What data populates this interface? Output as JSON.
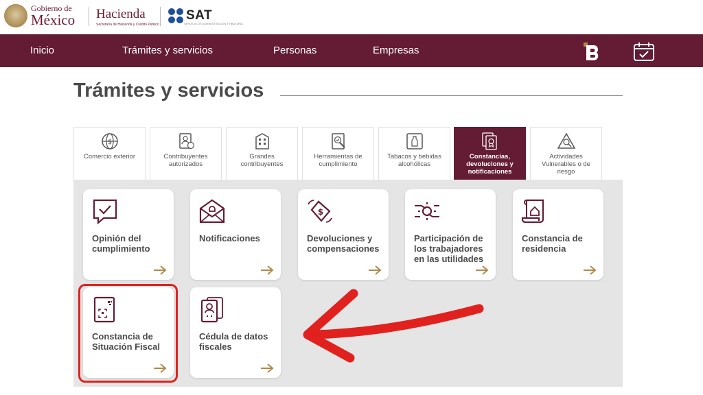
{
  "header": {
    "gob_small": "Gobierno de",
    "gob_big": "México",
    "hacienda_title": "Hacienda",
    "hacienda_sub": "Secretaría de Hacienda y Crédito Público",
    "sat_word": "SAT",
    "sat_sub": "SERVICIO DE ADMINISTRACIÓN TRIBUTARIA"
  },
  "nav": {
    "items": [
      "Inicio",
      "Trámites y servicios",
      "Personas",
      "Empresas"
    ],
    "icons": [
      "b-logo-icon",
      "calendar-check-icon"
    ],
    "color": "#641c34"
  },
  "page": {
    "title": "Trámites y servicios"
  },
  "tabs": [
    {
      "label": "Comercio exterior",
      "icon": "globe-dollar-icon",
      "active": false
    },
    {
      "label": "Contribuyentes autorizados",
      "icon": "document-user-icon",
      "active": false
    },
    {
      "label": "Grandes contribuyentes",
      "icon": "building-icon",
      "active": false
    },
    {
      "label": "Herramientas de cumplimiento",
      "icon": "document-check-icon",
      "active": false
    },
    {
      "label": "Tabacos y bebidas alcohólicas",
      "icon": "bottle-frame-icon",
      "active": false
    },
    {
      "label": "Constancias, devoluciones y notificaciones",
      "icon": "certificates-icon",
      "active": true
    },
    {
      "label": "Actividades Vulnerables o de riesgo",
      "icon": "warning-triangle-icon",
      "active": false
    }
  ],
  "cards": [
    {
      "label": "Opinión del cumplimiento",
      "icon": "chat-check-icon"
    },
    {
      "label": "Notificaciones",
      "icon": "envelope-bell-icon"
    },
    {
      "label": "Devoluciones y compensaciones",
      "icon": "money-exchange-icon"
    },
    {
      "label": "Participación de los trabajadores en las utilidades",
      "icon": "hands-gear-icon"
    },
    {
      "label": "Constancia de residencia",
      "icon": "scroll-house-icon"
    },
    {
      "label": "Constancia de Situación Fiscal",
      "icon": "qr-card-icon"
    },
    {
      "label": "Cédula de datos fiscales",
      "icon": "id-card-icon"
    }
  ],
  "colors": {
    "brand": "#641c34",
    "arrow_gold": "#b08a4a",
    "highlight_red": "#e1211e"
  }
}
